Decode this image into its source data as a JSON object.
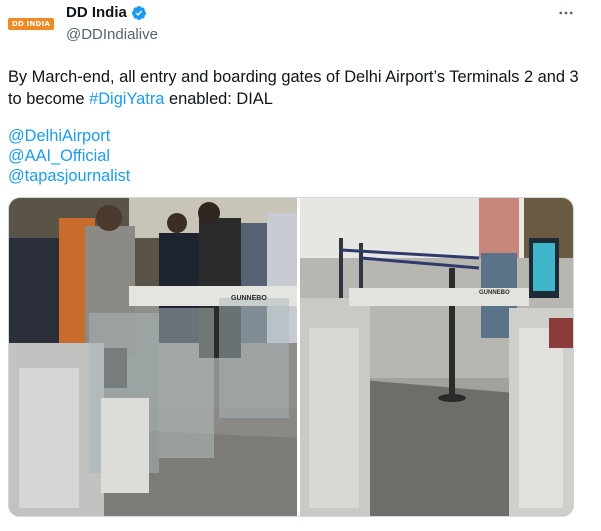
{
  "tweet": {
    "avatar_logo_text": "DD INDIA",
    "display_name": "DD India",
    "handle": "@DDIndialive",
    "more_glyph": "···",
    "text_before": "By March-end, all entry and boarding gates of Delhi Airport’s Terminals 2 and 3 to become ",
    "hashtag": "#DigiYatra",
    "text_after": " enabled: DIAL",
    "mentions": [
      "@DelhiAirport",
      "@AAI_Official",
      "@tapasjournalist"
    ],
    "media": {
      "left_image_signage": "GUNNEBO",
      "right_image_signage": "GUNNEBO"
    }
  },
  "colors": {
    "link": "#1d9bf0",
    "verified": "#1d9bf0",
    "secondary_text": "#536471",
    "logo": "#f08a24"
  },
  "icons": [
    "verified-badge-icon",
    "more-options-icon"
  ]
}
